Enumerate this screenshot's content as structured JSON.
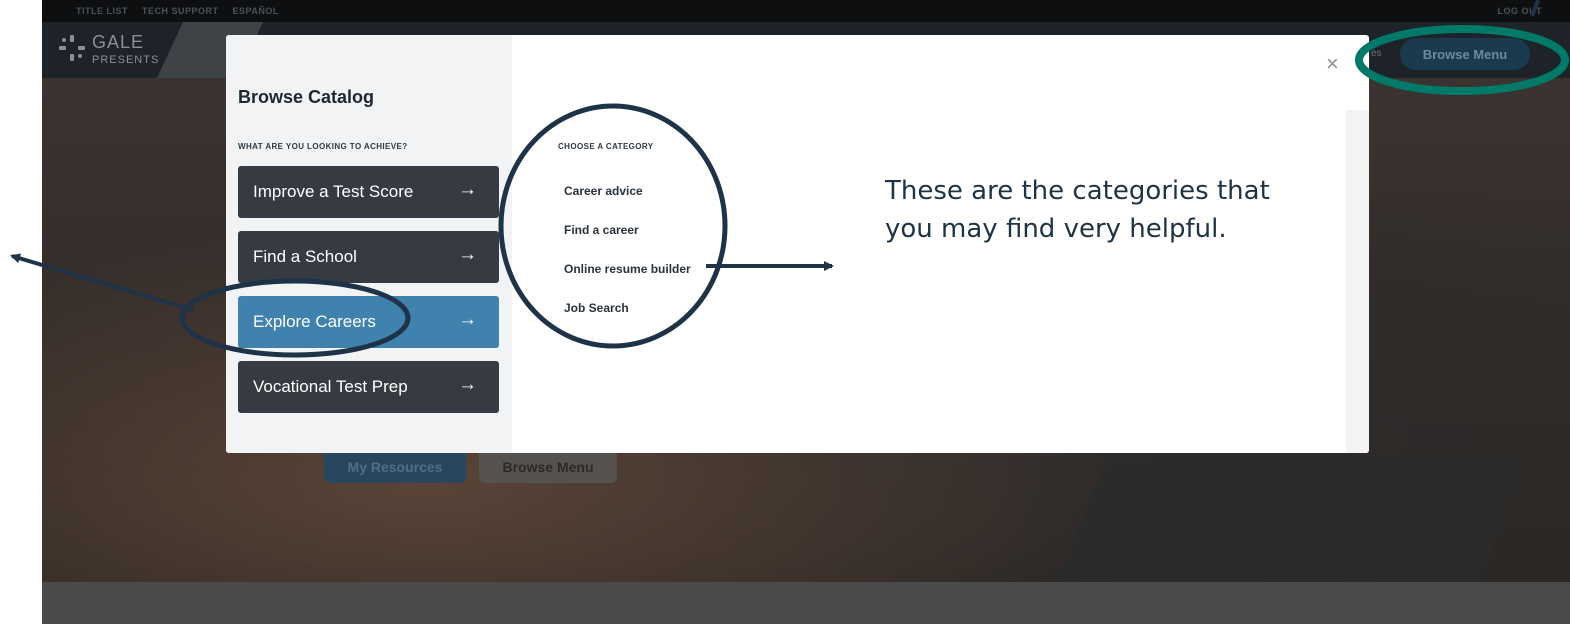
{
  "top_links": [
    "TITLE LIST",
    "TECH SUPPORT",
    "ESPAÑOL"
  ],
  "top_right": [
    "LOG OUT"
  ],
  "logo": {
    "name": "GALE",
    "sub": "PRESENTS"
  },
  "header": {
    "res_tail": "es",
    "browse_label": "Browse Menu"
  },
  "hero_buttons": {
    "primary": "My Resources",
    "secondary": "Browse Menu"
  },
  "modal": {
    "title": "Browse Catalog",
    "goal_heading": "WHAT ARE YOU LOOKING TO ACHIEVE?",
    "goals": [
      {
        "label": "Improve a Test Score",
        "arrow": "→",
        "active": false
      },
      {
        "label": "Find a School",
        "arrow": "→",
        "active": false
      },
      {
        "label": "Explore Careers",
        "arrow": "→",
        "active": true
      },
      {
        "label": "Vocational Test Prep",
        "arrow": "→",
        "active": false
      }
    ],
    "category_heading": "CHOOSE A CATEGORY",
    "categories": [
      "Career advice",
      "Find a career",
      "Online resume builder",
      "Job Search"
    ],
    "close_glyph": "×"
  },
  "annotation": {
    "text": "These are the categories that you may find very helpful.",
    "circle_color": "#1e3347",
    "highlight_color": "#007a68"
  },
  "colors": {
    "goal_button": "#363b43",
    "goal_active": "#3f82ad",
    "header_button": "#1a3a4e"
  }
}
